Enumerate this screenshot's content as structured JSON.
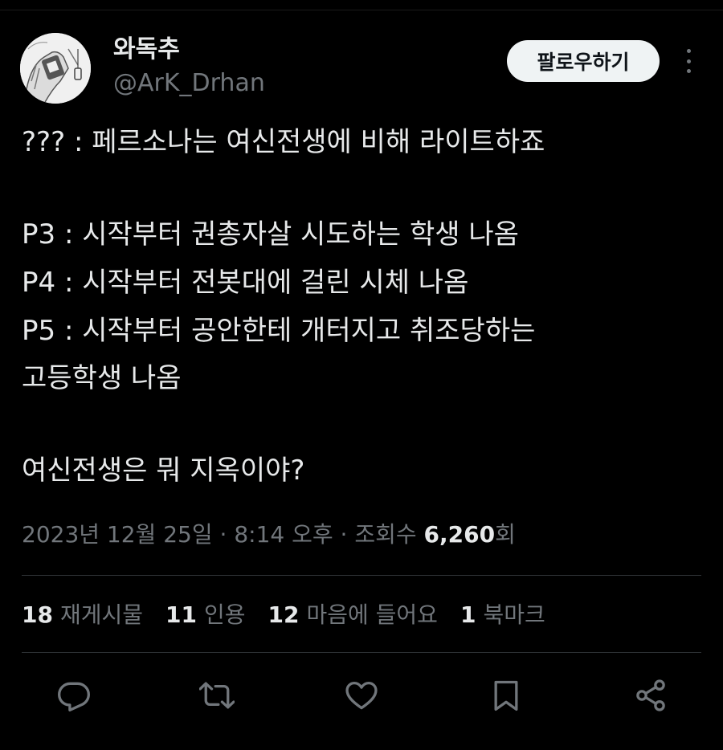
{
  "author": {
    "display_name": "와독추",
    "handle": "@ArK_Drhan"
  },
  "header": {
    "follow_label": "팔로우하기"
  },
  "tweet": {
    "lines": [
      "??? : 페르소나는 여신전생에 비해 라이트하죠",
      "P3 : 시작부터 권총자살 시도하는 학생 나옴",
      "P4 : 시작부터 전봇대에 걸린 시체 나옴",
      "P5 : 시작부터 공안한테 개터지고 취조당하는",
      "고등학생 나옴",
      "여신전생은 뭐 지옥이야?"
    ]
  },
  "meta": {
    "date": "2023년 12월 25일",
    "time": "8:14 오후",
    "views_label": "조회수",
    "views_count": "6,260",
    "views_suffix": "회",
    "separator": "·"
  },
  "stats": [
    {
      "count": "18",
      "label": "재게시물"
    },
    {
      "count": "11",
      "label": "인용"
    },
    {
      "count": "12",
      "label": "마음에 들어요"
    },
    {
      "count": "1",
      "label": "북마크"
    }
  ],
  "actions": [
    "reply-icon",
    "repost-icon",
    "like-icon",
    "bookmark-icon",
    "share-icon"
  ],
  "colors": {
    "background": "#000000",
    "text": "#e7e9ea",
    "secondary": "#71767b",
    "divider": "#2f3336",
    "button_bg": "#eff3f4"
  }
}
